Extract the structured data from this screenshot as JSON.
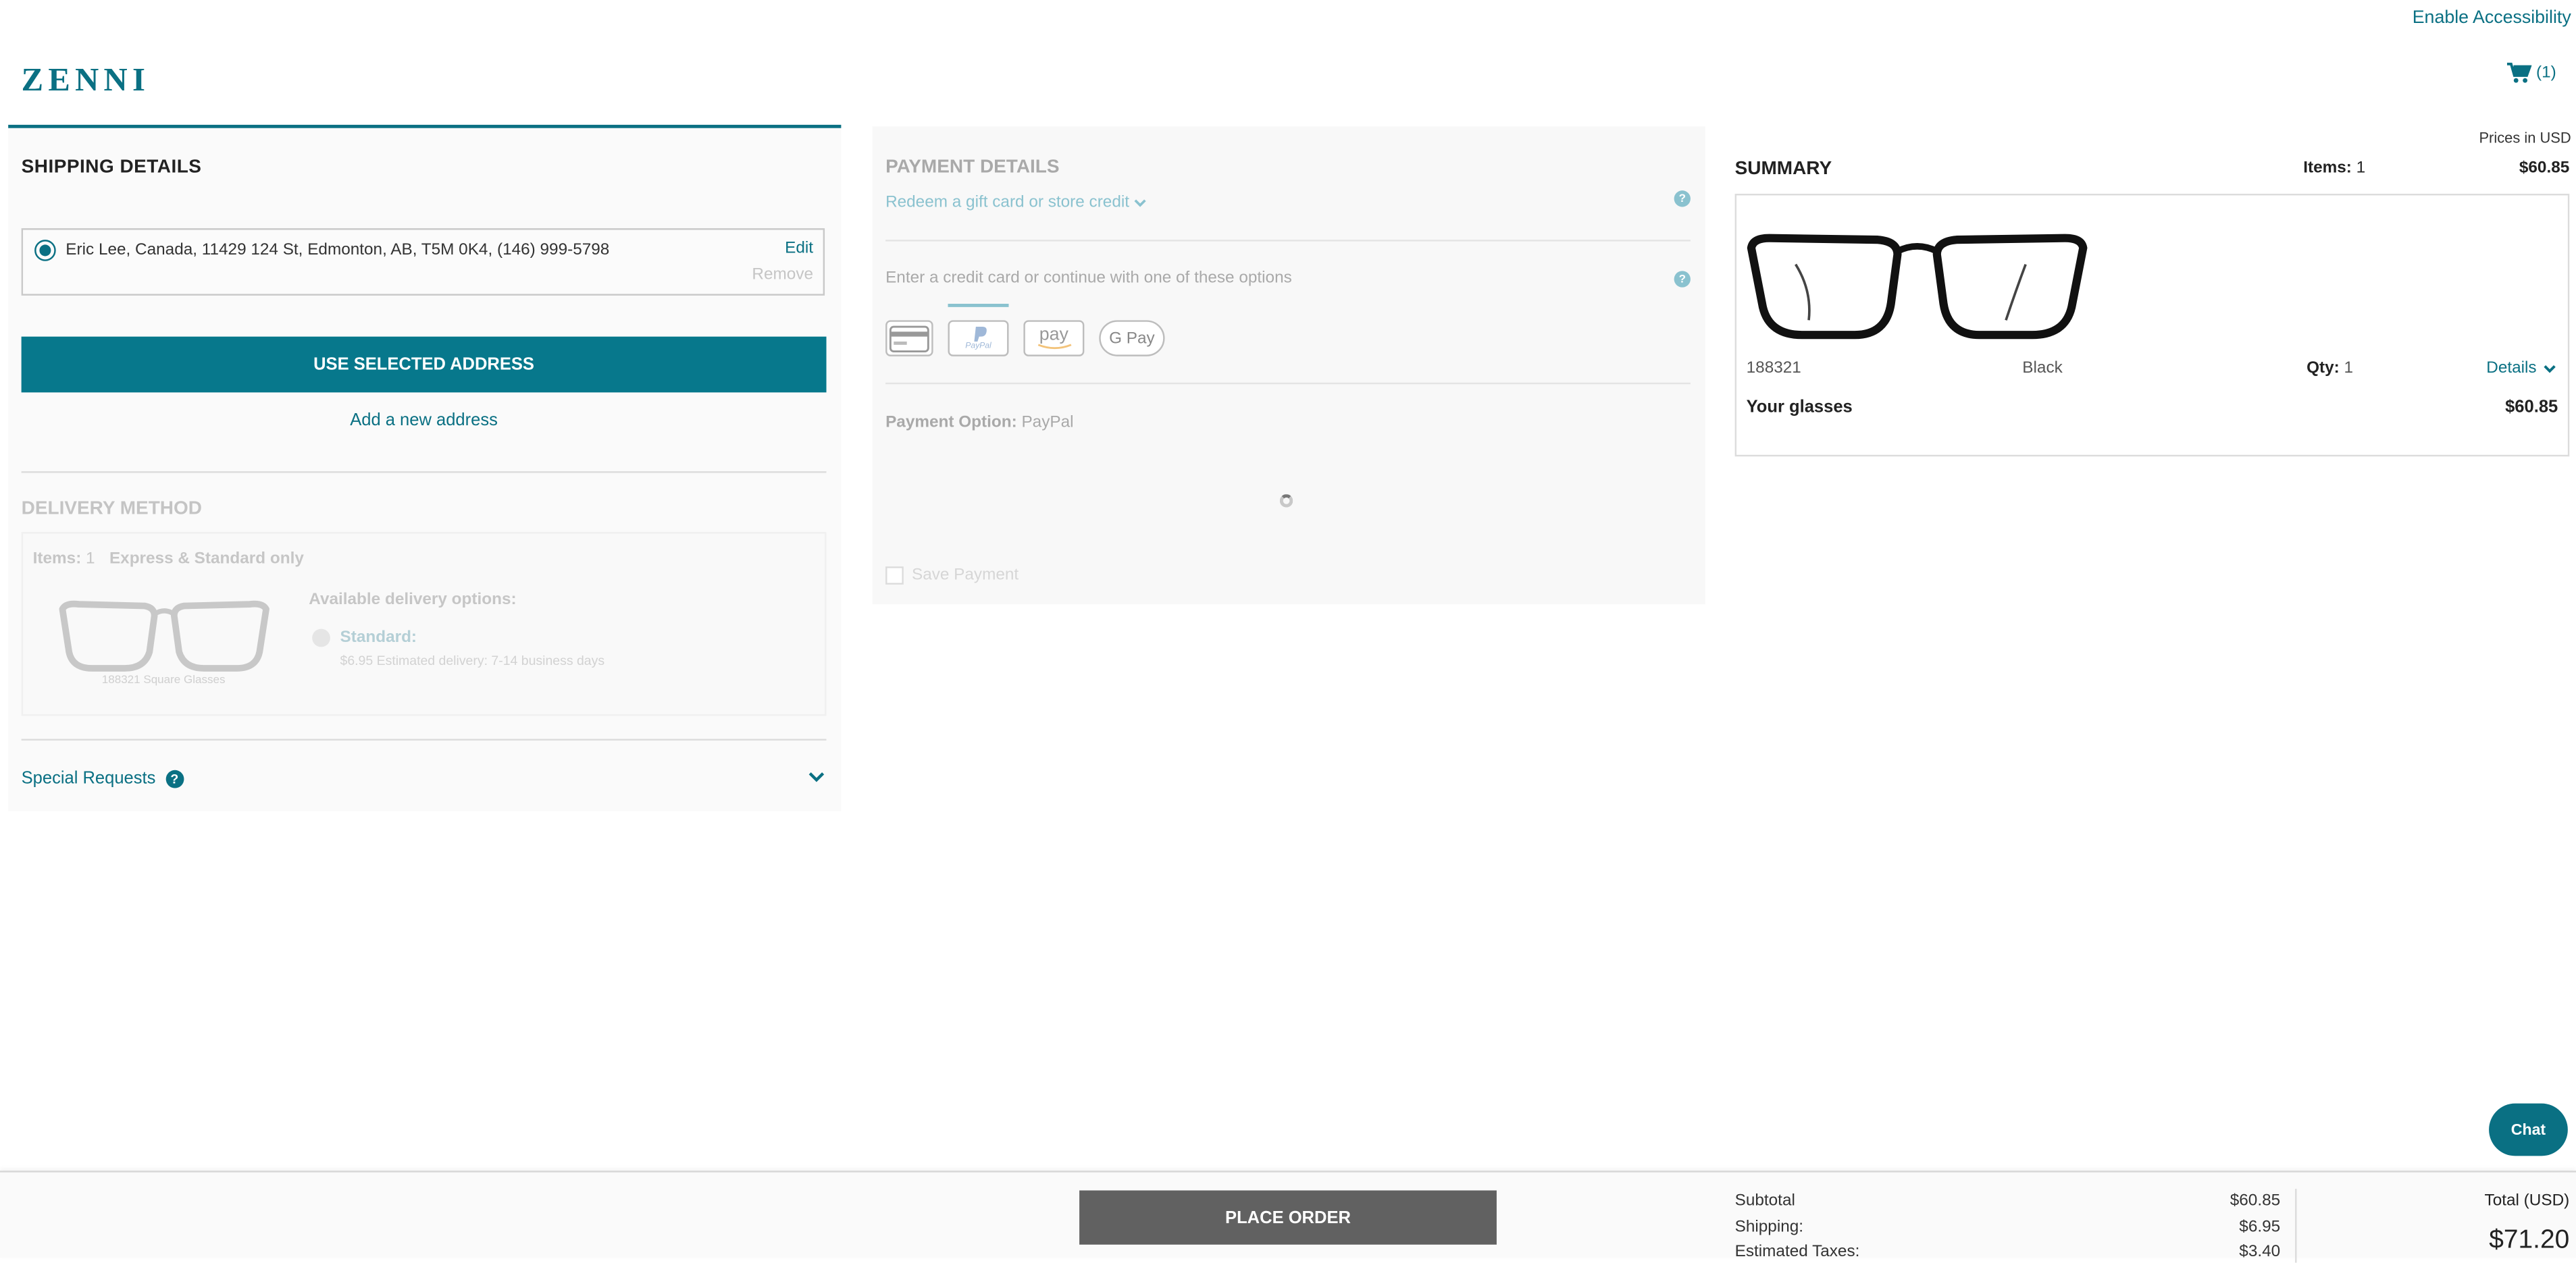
{
  "header": {
    "logo": "ZENNI",
    "accessibility": "Enable Accessibility",
    "cart_count": "(1)"
  },
  "shipping": {
    "title": "SHIPPING DETAILS",
    "address": "Eric Lee, Canada, 11429 124 St, Edmonton, AB, T5M 0K4, (146) 999-5798",
    "edit": "Edit",
    "remove": "Remove",
    "use_button": "USE SELECTED ADDRESS",
    "add_address": "Add a new address"
  },
  "delivery": {
    "title": "DELIVERY METHOD",
    "items_label": "Items:",
    "items_count": "1",
    "express_note": "Express & Standard only",
    "frame_caption": "188321 Square Glasses",
    "available_label": "Available delivery options:",
    "standard_label": "Standard:",
    "standard_detail": "$6.95 Estimated delivery: 7-14 business days"
  },
  "special_requests": "Special Requests",
  "payment": {
    "title": "PAYMENT DETAILS",
    "redeem": "Redeem a gift card or store credit",
    "enter_cc": "Enter a credit card or continue with one of these options",
    "methods": {
      "paypal": "PayPal",
      "amazon": "pay",
      "gpay": "G Pay"
    },
    "option_label": "Payment Option:",
    "option_value": "PayPal",
    "save_payment": "Save Payment"
  },
  "summary": {
    "prices_note": "Prices in USD",
    "title": "SUMMARY",
    "items_label": "Items:",
    "items_count": "1",
    "top_price": "$60.85",
    "sku": "188321",
    "color": "Black",
    "qty_label": "Qty:",
    "qty": "1",
    "details": "Details",
    "your_glasses": "Your glasses",
    "glasses_price": "$60.85"
  },
  "chat": "Chat",
  "footer": {
    "place_order": "PLACE ORDER",
    "subtotal_label": "Subtotal",
    "subtotal": "$60.85",
    "shipping_label": "Shipping:",
    "shipping": "$6.95",
    "tax_label": "Estimated Taxes:",
    "tax": "$3.40",
    "total_label": "Total (USD)",
    "total": "$71.20"
  },
  "colors": {
    "accent": "#0a7083",
    "place_order": "#616161",
    "light_accent": "#8ac2cf"
  }
}
